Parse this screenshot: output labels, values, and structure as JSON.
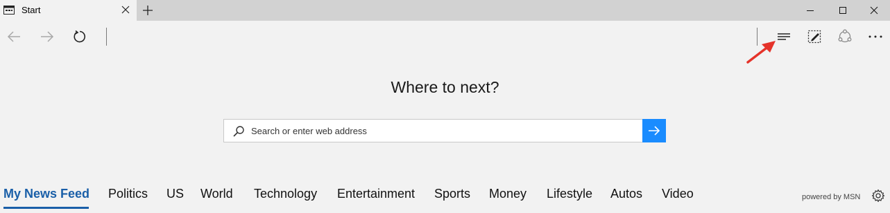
{
  "tab": {
    "title": "Start"
  },
  "headline": "Where to next?",
  "search": {
    "placeholder": "Search or enter web address",
    "value": ""
  },
  "news": {
    "categories": [
      "My News Feed",
      "Politics",
      "US",
      "World",
      "Technology",
      "Entertainment",
      "Sports",
      "Money",
      "Lifestyle",
      "Autos",
      "Video"
    ],
    "active_index": 0,
    "powered_by": "powered by MSN"
  },
  "colors": {
    "accent": "#1a8cff",
    "active_category": "#1a5fa8",
    "annotation": "#e5332a"
  },
  "icons": [
    "tab-page-icon",
    "close-icon",
    "plus-icon",
    "minimize-icon",
    "maximize-icon",
    "window-close-icon",
    "back-arrow-icon",
    "forward-arrow-icon",
    "refresh-icon",
    "hub-icon",
    "web-note-icon",
    "share-icon",
    "more-icon",
    "search-icon",
    "go-arrow-icon",
    "settings-gear-icon"
  ]
}
